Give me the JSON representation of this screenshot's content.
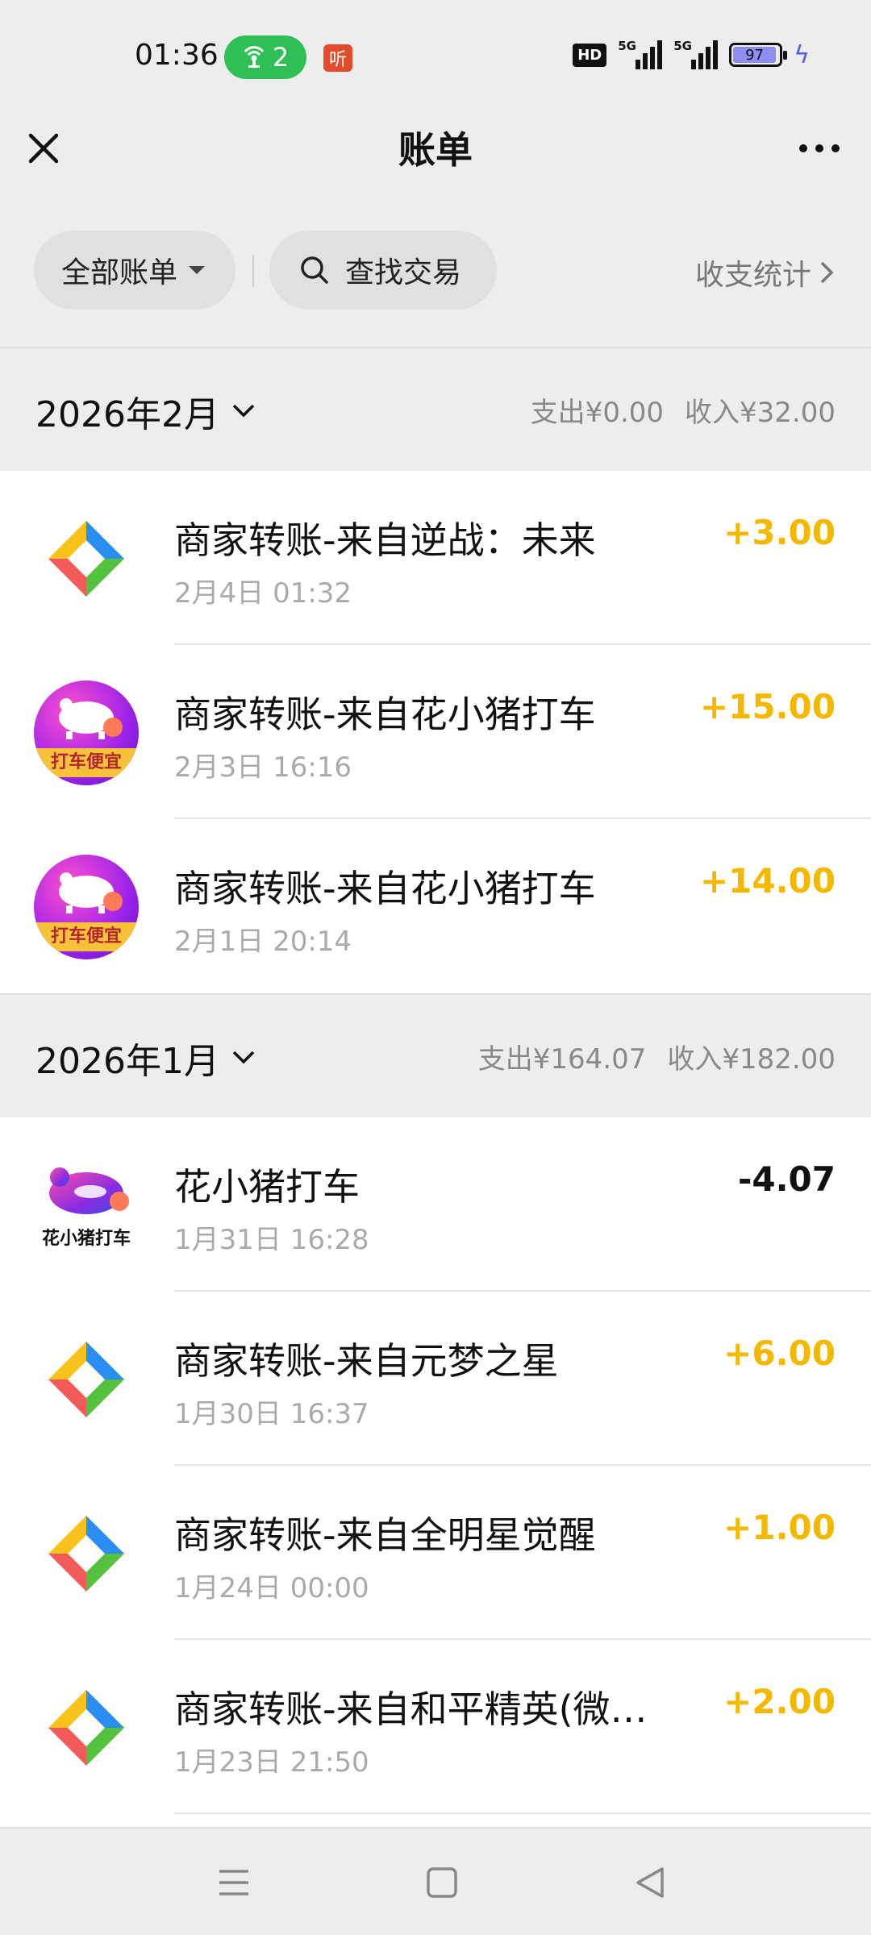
{
  "status_bar": {
    "time": "01:36",
    "hotspot_count": "2",
    "listen_label": "听",
    "hd_label": "HD",
    "sim1_label": "5G",
    "sim2_label": "5G",
    "battery": "97"
  },
  "header": {
    "title": "账单"
  },
  "filters": {
    "all_bills_label": "全部账单",
    "search_label": "查找交易",
    "stats_label": "收支统计"
  },
  "sections": [
    {
      "month": "2026年2月",
      "expense": "支出¥0.00",
      "income": "收入¥32.00",
      "transactions": [
        {
          "name": "商家转账-来自逆战：未来",
          "time": "2月4日 01:32",
          "amount": "+3.00",
          "type": "income",
          "icon": "merchant-icon"
        },
        {
          "name": "商家转账-来自花小猪打车",
          "time": "2月3日 16:16",
          "amount": "+15.00",
          "type": "income",
          "icon": "huaxiaozhu-badge-icon",
          "icon_text": "打车便宜"
        },
        {
          "name": "商家转账-来自花小猪打车",
          "time": "2月1日 20:14",
          "amount": "+14.00",
          "type": "income",
          "icon": "huaxiaozhu-badge-icon",
          "icon_text": "打车便宜"
        }
      ]
    },
    {
      "month": "2026年1月",
      "expense": "支出¥164.07",
      "income": "收入¥182.00",
      "transactions": [
        {
          "name": "花小猪打车",
          "time": "1月31日 16:28",
          "amount": "-4.07",
          "type": "expense",
          "icon": "huaxiaozhu-logo-icon",
          "icon_text": "花小猪打车"
        },
        {
          "name": "商家转账-来自元梦之星",
          "time": "1月30日 16:37",
          "amount": "+6.00",
          "type": "income",
          "icon": "merchant-icon"
        },
        {
          "name": "商家转账-来自全明星觉醒",
          "time": "1月24日 00:00",
          "amount": "+1.00",
          "type": "income",
          "icon": "merchant-icon"
        },
        {
          "name": "商家转账-来自和平精英(微信...",
          "time": "1月23日 21:50",
          "amount": "+2.00",
          "type": "income",
          "icon": "merchant-icon"
        }
      ]
    }
  ],
  "colors": {
    "income": "#f5b800",
    "expense": "#111111",
    "hotspot": "#2fbf55"
  }
}
